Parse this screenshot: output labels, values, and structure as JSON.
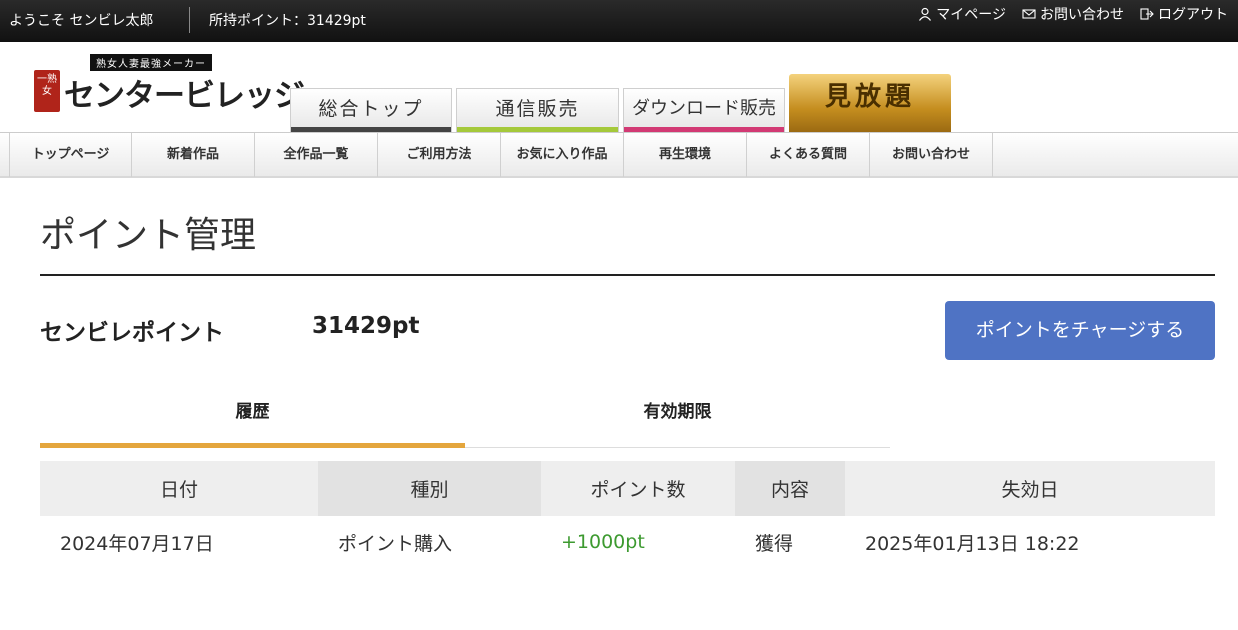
{
  "topbar": {
    "welcome": "ようこそ センビレ太郎",
    "points": "所持ポイント：31429pt",
    "mypage": "マイページ",
    "contact": "お問い合わせ",
    "logout": "ログアウト"
  },
  "logo": {
    "tagline": "熟女人妻最強メーカー",
    "emblem": "一熟女",
    "name": "センタービレッジ"
  },
  "tabs": [
    {
      "label": "総合トップ",
      "color": "#444444"
    },
    {
      "label": "通信販売",
      "color": "#a5c93b"
    },
    {
      "label": "ダウンロード販売",
      "color": "#d23a74"
    },
    {
      "label": "見放題"
    }
  ],
  "nav": [
    "トップページ",
    "新着作品",
    "全作品一覧",
    "ご利用方法",
    "お気に入り作品",
    "再生環境",
    "よくある質問",
    "お問い合わせ"
  ],
  "page": {
    "title": "ポイント管理",
    "point_label": "センビレポイント",
    "point_value": "31429pt",
    "charge_button": "ポイントをチャージする"
  },
  "subtabs": [
    "履歴",
    "有効期限"
  ],
  "table": {
    "headers": [
      "日付",
      "種別",
      "ポイント数",
      "内容",
      "失効日"
    ],
    "rows": [
      [
        "2024年07月17日",
        "ポイント購入",
        "+1000pt",
        "獲得",
        "2025年01月13日 18:22"
      ]
    ]
  },
  "colors": {
    "accent": "#4f73c4",
    "tab_active": "#e4a63d",
    "positive": "#3d9a30"
  }
}
